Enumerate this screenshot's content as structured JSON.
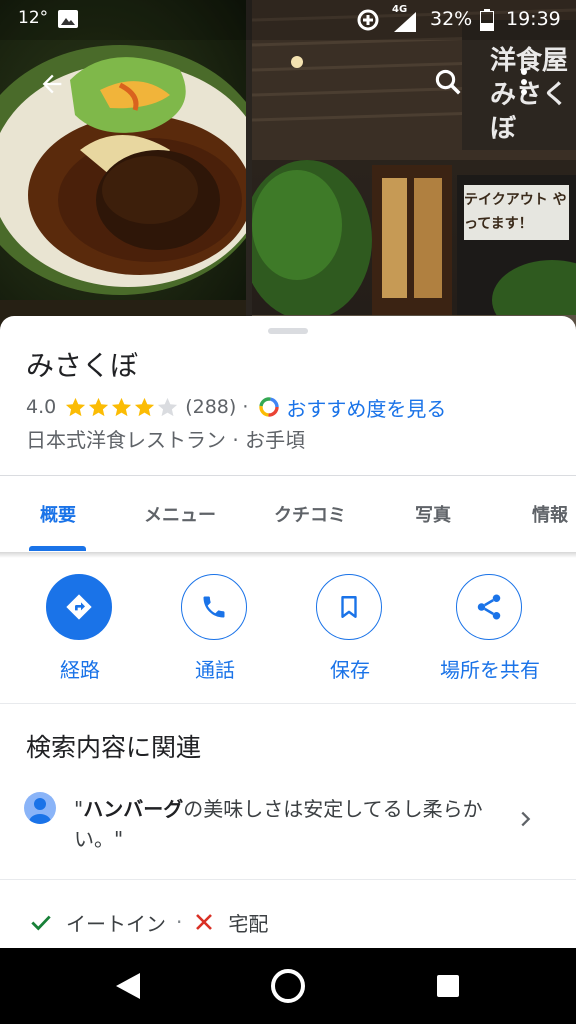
{
  "status_bar": {
    "temperature": "12°",
    "network_type": "4G",
    "battery": "32%",
    "time": "19:39"
  },
  "photo_overlay": {
    "storefront_sign": "洋食屋 みさくぼ",
    "storefront_notice": "テイクアウト やってます！"
  },
  "place": {
    "name": "みさくぼ",
    "rating": "4.0",
    "rating_value": 4.0,
    "review_count": "(288)",
    "separator": "·",
    "recommend_link": "おすすめ度を見る",
    "category": "日本式洋食レストラン · お手頃"
  },
  "tabs": [
    {
      "label": "概要",
      "active": true
    },
    {
      "label": "メニュー",
      "active": false
    },
    {
      "label": "クチコミ",
      "active": false
    },
    {
      "label": "写真",
      "active": false
    },
    {
      "label": "情報",
      "active": false
    }
  ],
  "actions": [
    {
      "label": "経路",
      "icon": "directions-icon"
    },
    {
      "label": "通話",
      "icon": "phone-icon"
    },
    {
      "label": "保存",
      "icon": "bookmark-icon"
    },
    {
      "label": "場所を共有",
      "icon": "share-icon"
    }
  ],
  "related": {
    "heading": "検索内容に関連",
    "review_open_quote": "\"",
    "review_highlight": "ハンバーグ",
    "review_rest": "の美味しさは安定してるし柔らかい。\""
  },
  "services": {
    "dine_in": "イートイン",
    "separator": "·",
    "delivery": "宅配"
  },
  "colors": {
    "accent": "#1a73e8",
    "star": "#fbbc04",
    "negative": "#d93025",
    "positive": "#188038"
  }
}
